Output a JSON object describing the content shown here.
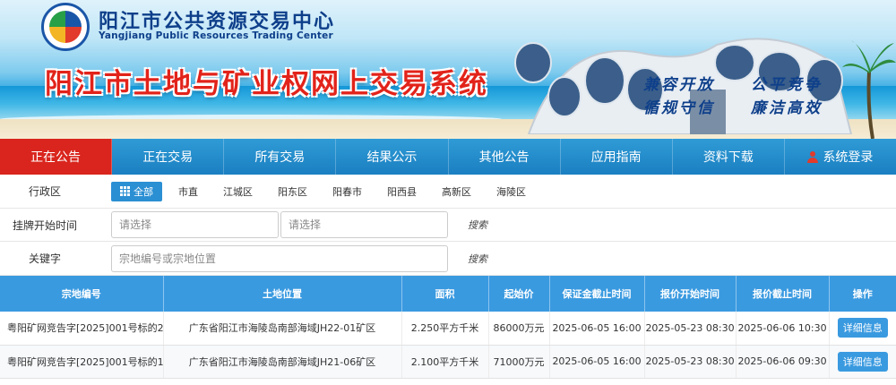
{
  "header": {
    "org_cn": "阳江市公共资源交易中心",
    "org_en": "Yangjiang Public Resources Trading Center",
    "system_title": "阳江市土地与矿业权网上交易系统",
    "slogans": [
      "兼容开放",
      "公平竞争",
      "循规守信",
      "廉洁高效"
    ]
  },
  "nav": {
    "items": [
      "正在公告",
      "正在交易",
      "所有交易",
      "结果公示",
      "其他公告",
      "应用指南",
      "资料下载"
    ],
    "login": "系统登录"
  },
  "filters": {
    "region_label": "行政区",
    "regions": [
      "全部",
      "市直",
      "江城区",
      "阳东区",
      "阳春市",
      "阳西县",
      "高新区",
      "海陵区"
    ],
    "date_label": "挂牌开始时间",
    "date_placeholder": "请选择",
    "keyword_label": "关键字",
    "keyword_placeholder": "宗地编号或宗地位置",
    "search_label": "搜索"
  },
  "table": {
    "headers": [
      "宗地编号",
      "土地位置",
      "面积",
      "起始价",
      "保证金截止时间",
      "报价开始时间",
      "报价截止时间",
      "操作"
    ],
    "rows": [
      {
        "id": "粤阳矿网竞告字[2025]001号标的2",
        "location": "广东省阳江市海陵岛南部海域JH22-01矿区",
        "area": "2.250平方千米",
        "price": "86000万元",
        "deposit_deadline": "2025-06-05 16:00",
        "bid_start": "2025-05-23 08:30",
        "bid_end": "2025-06-06 10:30",
        "action": "详细信息"
      },
      {
        "id": "粤阳矿网竞告字[2025]001号标的1",
        "location": "广东省阳江市海陵岛南部海域JH21-06矿区",
        "area": "2.100平方千米",
        "price": "71000万元",
        "deposit_deadline": "2025-06-05 16:00",
        "bid_start": "2025-05-23 08:30",
        "bid_end": "2025-06-06 09:30",
        "action": "详细信息"
      }
    ]
  }
}
